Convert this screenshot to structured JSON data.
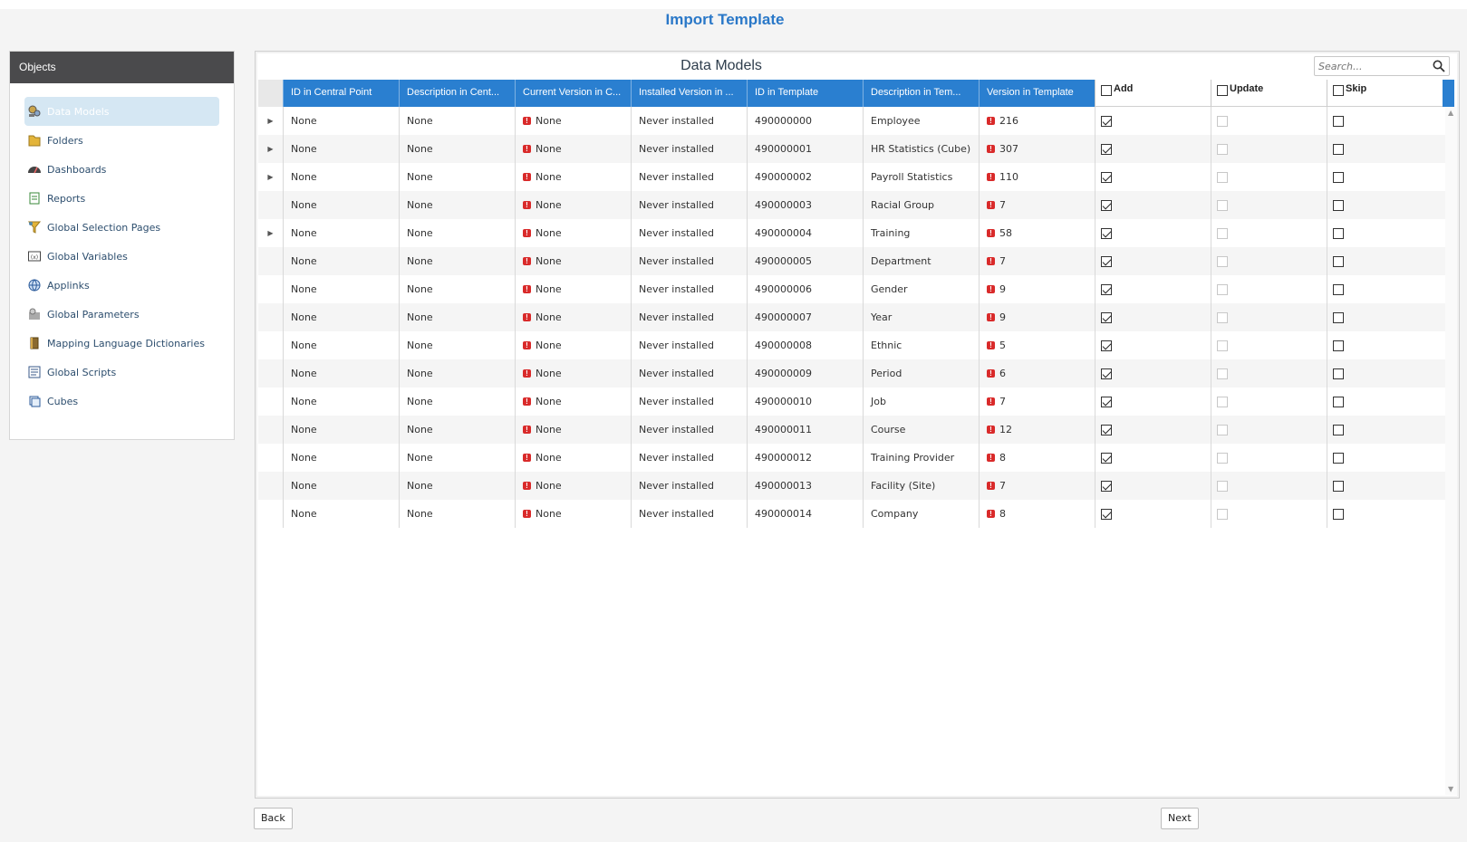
{
  "page": {
    "title": "Import Template"
  },
  "sidebar": {
    "header": "Objects",
    "items": [
      {
        "label": "Data Models",
        "icon": "data-models-icon",
        "active": true
      },
      {
        "label": "Folders",
        "icon": "folder-icon"
      },
      {
        "label": "Dashboards",
        "icon": "dashboard-icon"
      },
      {
        "label": "Reports",
        "icon": "report-icon"
      },
      {
        "label": "Global Selection Pages",
        "icon": "selection-pages-icon"
      },
      {
        "label": "Global Variables",
        "icon": "variables-icon"
      },
      {
        "label": "Applinks",
        "icon": "applinks-icon"
      },
      {
        "label": "Global Parameters",
        "icon": "parameters-icon"
      },
      {
        "label": "Mapping Language Dictionaries",
        "icon": "dictionary-icon"
      },
      {
        "label": "Global Scripts",
        "icon": "scripts-icon"
      },
      {
        "label": "Cubes",
        "icon": "cubes-icon"
      }
    ]
  },
  "panel": {
    "title": "Data Models",
    "search_placeholder": "Search..."
  },
  "grid": {
    "columns": [
      "ID in Central Point",
      "Description in Cent...",
      "Current Version in C...",
      "Installed Version in ...",
      "ID in Template",
      "Description in Tem...",
      "Version in Template"
    ],
    "check_columns": [
      "Add",
      "Update",
      "Skip"
    ],
    "rows": [
      {
        "expand": true,
        "id_cp": "None",
        "desc_cp": "None",
        "cur_ver": "None",
        "inst_ver": "Never installed",
        "id_t": "490000000",
        "desc_t": "Employee",
        "ver_t": "216",
        "add": true,
        "update": false,
        "skip": false
      },
      {
        "expand": true,
        "id_cp": "None",
        "desc_cp": "None",
        "cur_ver": "None",
        "inst_ver": "Never installed",
        "id_t": "490000001",
        "desc_t": "HR Statistics (Cube)",
        "ver_t": "307",
        "add": true,
        "update": false,
        "skip": false
      },
      {
        "expand": true,
        "id_cp": "None",
        "desc_cp": "None",
        "cur_ver": "None",
        "inst_ver": "Never installed",
        "id_t": "490000002",
        "desc_t": "Payroll Statistics",
        "ver_t": "110",
        "add": true,
        "update": false,
        "skip": false
      },
      {
        "expand": false,
        "id_cp": "None",
        "desc_cp": "None",
        "cur_ver": "None",
        "inst_ver": "Never installed",
        "id_t": "490000003",
        "desc_t": "Racial Group",
        "ver_t": "7",
        "add": true,
        "update": false,
        "skip": false
      },
      {
        "expand": true,
        "id_cp": "None",
        "desc_cp": "None",
        "cur_ver": "None",
        "inst_ver": "Never installed",
        "id_t": "490000004",
        "desc_t": "Training",
        "ver_t": "58",
        "add": true,
        "update": false,
        "skip": false
      },
      {
        "expand": false,
        "id_cp": "None",
        "desc_cp": "None",
        "cur_ver": "None",
        "inst_ver": "Never installed",
        "id_t": "490000005",
        "desc_t": "Department",
        "ver_t": "7",
        "add": true,
        "update": false,
        "skip": false
      },
      {
        "expand": false,
        "id_cp": "None",
        "desc_cp": "None",
        "cur_ver": "None",
        "inst_ver": "Never installed",
        "id_t": "490000006",
        "desc_t": "Gender",
        "ver_t": "9",
        "add": true,
        "update": false,
        "skip": false
      },
      {
        "expand": false,
        "id_cp": "None",
        "desc_cp": "None",
        "cur_ver": "None",
        "inst_ver": "Never installed",
        "id_t": "490000007",
        "desc_t": "Year",
        "ver_t": "9",
        "add": true,
        "update": false,
        "skip": false
      },
      {
        "expand": false,
        "id_cp": "None",
        "desc_cp": "None",
        "cur_ver": "None",
        "inst_ver": "Never installed",
        "id_t": "490000008",
        "desc_t": "Ethnic",
        "ver_t": "5",
        "add": true,
        "update": false,
        "skip": false
      },
      {
        "expand": false,
        "id_cp": "None",
        "desc_cp": "None",
        "cur_ver": "None",
        "inst_ver": "Never installed",
        "id_t": "490000009",
        "desc_t": "Period",
        "ver_t": "6",
        "add": true,
        "update": false,
        "skip": false
      },
      {
        "expand": false,
        "id_cp": "None",
        "desc_cp": "None",
        "cur_ver": "None",
        "inst_ver": "Never installed",
        "id_t": "490000010",
        "desc_t": "Job",
        "ver_t": "7",
        "add": true,
        "update": false,
        "skip": false
      },
      {
        "expand": false,
        "id_cp": "None",
        "desc_cp": "None",
        "cur_ver": "None",
        "inst_ver": "Never installed",
        "id_t": "490000011",
        "desc_t": "Course",
        "ver_t": "12",
        "add": true,
        "update": false,
        "skip": false
      },
      {
        "expand": false,
        "id_cp": "None",
        "desc_cp": "None",
        "cur_ver": "None",
        "inst_ver": "Never installed",
        "id_t": "490000012",
        "desc_t": "Training Provider",
        "ver_t": "8",
        "add": true,
        "update": false,
        "skip": false
      },
      {
        "expand": false,
        "id_cp": "None",
        "desc_cp": "None",
        "cur_ver": "None",
        "inst_ver": "Never installed",
        "id_t": "490000013",
        "desc_t": "Facility (Site)",
        "ver_t": "7",
        "add": true,
        "update": false,
        "skip": false
      },
      {
        "expand": false,
        "id_cp": "None",
        "desc_cp": "None",
        "cur_ver": "None",
        "inst_ver": "Never installed",
        "id_t": "490000014",
        "desc_t": "Company",
        "ver_t": "8",
        "add": true,
        "update": false,
        "skip": false
      }
    ]
  },
  "buttons": {
    "back": "Back",
    "next": "Next"
  }
}
